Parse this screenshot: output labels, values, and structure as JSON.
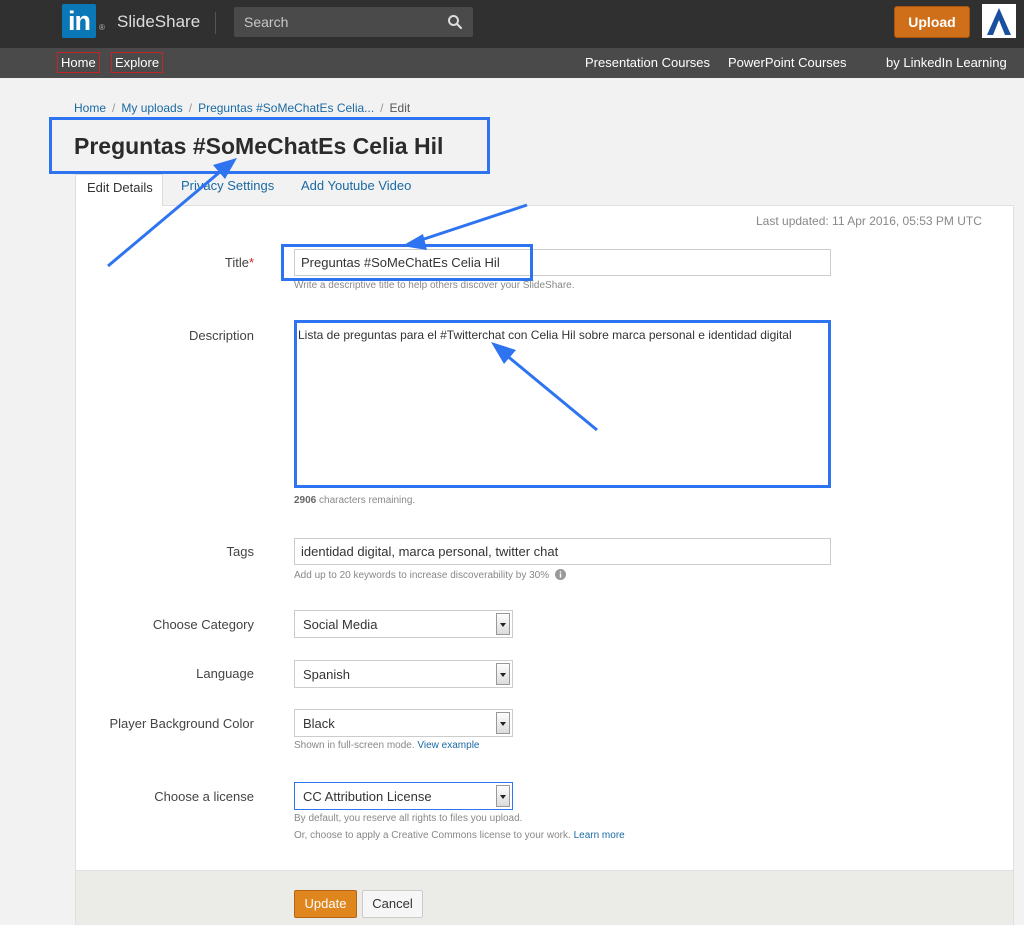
{
  "header": {
    "logo_text": "in",
    "logo_reg": "®",
    "brand": "SlideShare",
    "search_placeholder": "Search",
    "upload_label": "Upload"
  },
  "nav": {
    "left": [
      "Home",
      "Explore"
    ],
    "right": [
      "Presentation Courses",
      "PowerPoint Courses",
      "by LinkedIn Learning"
    ]
  },
  "breadcrumb": [
    "Home",
    "My uploads",
    "Preguntas #SoMeChatEs Celia...",
    "Edit"
  ],
  "page_title": "Preguntas #SoMeChatEs Celia Hil",
  "tabs": [
    "Edit Details",
    "Privacy Settings",
    "Add Youtube Video"
  ],
  "last_updated": "Last updated: 11 Apr 2016, 05:53 PM UTC",
  "form": {
    "title": {
      "label": "Title",
      "required": "*",
      "value": "Preguntas #SoMeChatEs Celia Hil",
      "help": "Write a descriptive title to help others discover your SlideShare."
    },
    "description": {
      "label": "Description",
      "value": "Lista de preguntas para el #Twitterchat con Celia Hil sobre marca personal e identidad digital",
      "remaining_count": "2906",
      "remaining_text": " characters remaining."
    },
    "tags": {
      "label": "Tags",
      "value": "identidad digital, marca personal, twitter chat",
      "help": "Add up to 20 keywords to increase discoverability by 30%"
    },
    "category": {
      "label": "Choose Category",
      "value": "Social Media"
    },
    "language": {
      "label": "Language",
      "value": "Spanish"
    },
    "player_bg": {
      "label": "Player Background Color",
      "value": "Black",
      "help": "Shown in full-screen mode.",
      "help_link": "View example"
    },
    "license": {
      "label": "Choose a license",
      "value": "CC Attribution License",
      "help1": "By default, you reserve all rights to files you upload.",
      "help2": "Or, choose to apply a Creative Commons license to your work.",
      "help2_link": "Learn more"
    }
  },
  "buttons": {
    "update": "Update",
    "cancel": "Cancel"
  },
  "colors": {
    "annotation": "#2e74f0",
    "upload": "#d06f1a",
    "update": "#e0861f",
    "link": "#1a6aa3",
    "linkedin": "#0a78b7"
  }
}
